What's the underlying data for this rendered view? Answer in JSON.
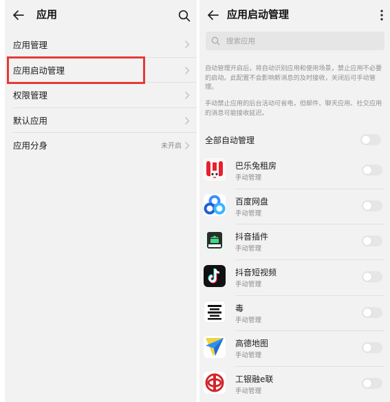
{
  "left": {
    "header": {
      "title": "应用"
    },
    "menu": [
      {
        "label": "应用管理"
      },
      {
        "label": "应用启动管理"
      },
      {
        "label": "权限管理"
      },
      {
        "label": "默认应用"
      },
      {
        "label": "应用分身",
        "value": "未开启"
      }
    ],
    "highlight_color": "#e53935"
  },
  "right": {
    "header": {
      "title": "应用启动管理"
    },
    "search": {
      "placeholder": "搜索应用"
    },
    "description1": "自动管理开启后，将自动识别应用和使用场景，禁止应用不必要的启动。此配置不会影响新消息的及时接收，关闭后可手动管理。",
    "description2": "手动禁止应用的后台活动可省电，但邮件、聊天应用、社交应用的消息可能接收延迟。",
    "all_auto": {
      "label": "全部自动管理",
      "enabled": false
    },
    "apps": [
      {
        "name": "巴乐兔租房",
        "status": "手动管理",
        "icon": "baletu-icon",
        "enabled": false
      },
      {
        "name": "百度网盘",
        "status": "手动管理",
        "icon": "baidu-netdisk-icon",
        "enabled": false
      },
      {
        "name": "抖音插件",
        "status": "手动管理",
        "icon": "douyin-plugin-icon",
        "icon_text": "APK",
        "enabled": false
      },
      {
        "name": "抖音短视频",
        "status": "手动管理",
        "icon": "douyin-icon",
        "enabled": false
      },
      {
        "name": "毒",
        "status": "手动管理",
        "icon": "du-icon",
        "icon_text": "毒",
        "enabled": false
      },
      {
        "name": "高德地图",
        "status": "手动管理",
        "icon": "amap-icon",
        "enabled": false
      },
      {
        "name": "工银融e联",
        "status": "手动管理",
        "icon": "icbc-icon",
        "enabled": false
      }
    ],
    "toggle_off_color": "#e6e6e6"
  }
}
